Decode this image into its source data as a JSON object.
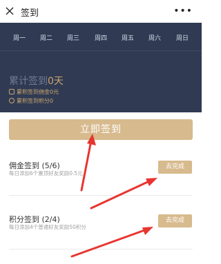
{
  "nav": {
    "title": "签到",
    "more": "•••"
  },
  "week": {
    "days": [
      "周一",
      "周二",
      "周三",
      "周四",
      "周五",
      "周六",
      "周日"
    ]
  },
  "summary": {
    "label": "累计签到",
    "count": "0天",
    "commission": "累积签到佣金0元",
    "points": "累积签到积分0"
  },
  "signin_button": "立即签到",
  "tasks": [
    {
      "title": "佣金签到 (5/6)",
      "desc": "每日添加6个置顶好友奖励0.5元",
      "button": "去完成"
    },
    {
      "title": "积分签到 (2/4)",
      "desc": "每日添加4个普通好友奖励50积分",
      "button": "去完成"
    }
  ],
  "colors": {
    "panel": "#303b53",
    "accent": "#d7ba8d",
    "arrow": "#e8352f"
  }
}
